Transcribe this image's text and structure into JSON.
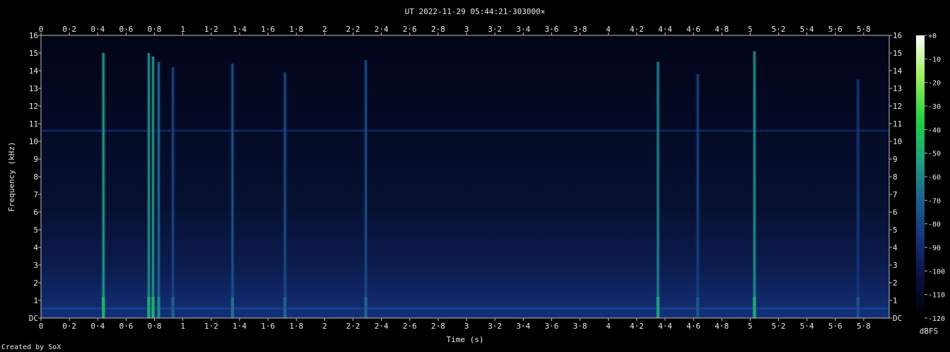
{
  "chart_data": {
    "type": "heatmap",
    "title": "UT 2022-11-29 05:44:21·303000×",
    "xlabel": "Time (s)",
    "ylabel": "Frequency (kHz)",
    "xlim": [
      0,
      5.98
    ],
    "ylim": [
      0,
      16
    ],
    "x_ticks": [
      "0",
      "0·2",
      "0·4",
      "0·6",
      "0·8",
      "1",
      "1·2",
      "1·4",
      "1·6",
      "1·8",
      "2",
      "2·2",
      "2·4",
      "2·6",
      "2·8",
      "3",
      "3·2",
      "3·4",
      "3·6",
      "3·8",
      "4",
      "4·2",
      "4·4",
      "4·6",
      "4·8",
      "5",
      "5·2",
      "5·4",
      "5·6",
      "5·8"
    ],
    "y_ticks": [
      "DC",
      "1",
      "2",
      "3",
      "4",
      "5",
      "6",
      "7",
      "8",
      "9",
      "10",
      "11",
      "12",
      "13",
      "14",
      "15",
      "16"
    ],
    "colorbar": {
      "label": "dBFS",
      "range": [
        -120,
        0
      ],
      "ticks": [
        "+0",
        "-10",
        "-20",
        "-30",
        "-40",
        "-50",
        "-60",
        "-70",
        "-80",
        "-90",
        "-100",
        "-110",
        "-120"
      ],
      "colors": [
        "#000000",
        "#0a0f3c",
        "#14327a",
        "#1e6090",
        "#20a080",
        "#20d040",
        "#a0f060",
        "#ffffff"
      ]
    },
    "background_dbfs": -110,
    "horizontal_lines": [
      {
        "freq_khz": 10.6,
        "dbfs": -92
      },
      {
        "freq_khz": 0.55,
        "dbfs": -80
      }
    ],
    "events": [
      {
        "time_s": 0.44,
        "top_khz": 15.0,
        "dbfs": -55
      },
      {
        "time_s": 0.76,
        "top_khz": 15.0,
        "dbfs": -58
      },
      {
        "time_s": 0.79,
        "top_khz": 14.8,
        "dbfs": -56
      },
      {
        "time_s": 0.83,
        "top_khz": 14.5,
        "dbfs": -68
      },
      {
        "time_s": 0.93,
        "top_khz": 14.2,
        "dbfs": -80
      },
      {
        "time_s": 1.35,
        "top_khz": 14.4,
        "dbfs": -75
      },
      {
        "time_s": 1.72,
        "top_khz": 13.9,
        "dbfs": -78
      },
      {
        "time_s": 2.29,
        "top_khz": 14.6,
        "dbfs": -78
      },
      {
        "time_s": 4.35,
        "top_khz": 14.5,
        "dbfs": -62
      },
      {
        "time_s": 4.63,
        "top_khz": 13.8,
        "dbfs": -82
      },
      {
        "time_s": 5.03,
        "top_khz": 15.1,
        "dbfs": -58
      },
      {
        "time_s": 5.76,
        "top_khz": 13.5,
        "dbfs": -85
      }
    ]
  },
  "footer": {
    "credit": "Created by SoX"
  }
}
